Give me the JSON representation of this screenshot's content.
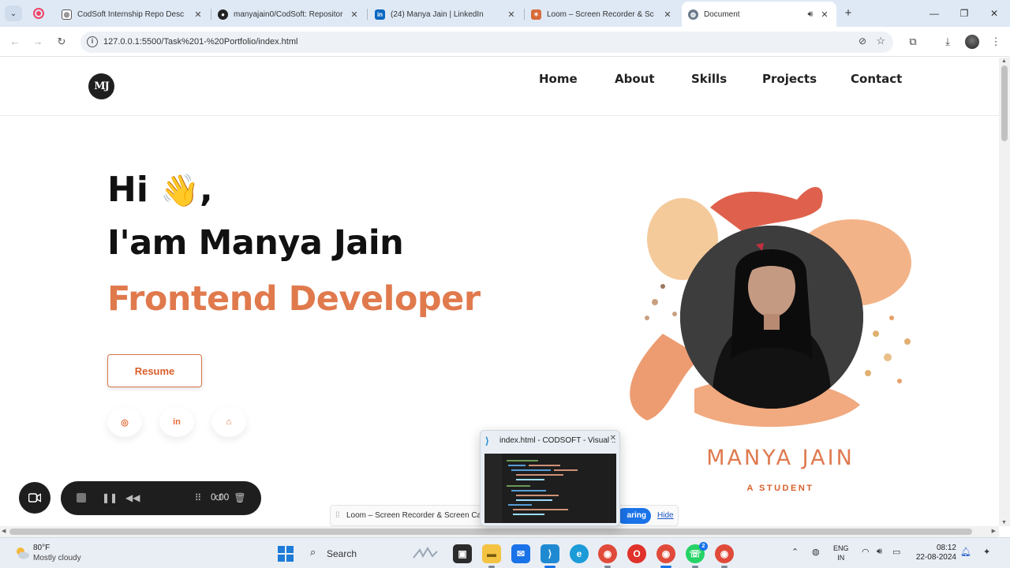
{
  "browser": {
    "tabs": [
      {
        "title": "CodSoft Internship Repo Desc",
        "icon": "chatgpt-icon",
        "active": false
      },
      {
        "title": "manyajain0/CodSoft: Repositor",
        "icon": "github-icon",
        "active": false
      },
      {
        "title": "(24) Manya Jain | LinkedIn",
        "icon": "linkedin-icon",
        "active": false
      },
      {
        "title": "Loom – Screen Recorder & Sc",
        "icon": "loom-icon",
        "active": false
      },
      {
        "title": "Document",
        "icon": "globe-icon",
        "active": true
      }
    ],
    "address": {
      "url": "127.0.0.1:5500/Task%201-%20Portfolio/index.html"
    }
  },
  "site": {
    "logo": "MJ",
    "nav": [
      "Home",
      "About",
      "Skills",
      "Projects",
      "Contact"
    ],
    "greeting": "Hi",
    "wave": "👋",
    "greeting_comma": ",",
    "intro": "I'am Manya Jain",
    "role": "Frontend Developer",
    "resume_label": "Resume",
    "social": [
      "instagram-icon",
      "linkedin-icon",
      "github-icon"
    ],
    "social_glyphs": [
      "◎",
      "in",
      "⌂"
    ],
    "profile_name": "MANYA JAIN",
    "profile_tagline": "A STUDENT",
    "accent": "#e07a4d"
  },
  "loom": {
    "timer": "0:00",
    "share_text": "Loom – Screen Recorder & Screen Capture is sharing your screen.",
    "stop_label": "aring",
    "hide_label": "Hide"
  },
  "preview": {
    "title": "index.html - CODSOFT - Visual ..."
  },
  "taskbar": {
    "weather_temp": "80°F",
    "weather_desc": "Mostly cloudy",
    "search_label": "Search",
    "lang_line1": "ENG",
    "lang_line2": "IN",
    "time": "08:12",
    "date": "22-08-2024",
    "whatsapp_badge": "2"
  }
}
